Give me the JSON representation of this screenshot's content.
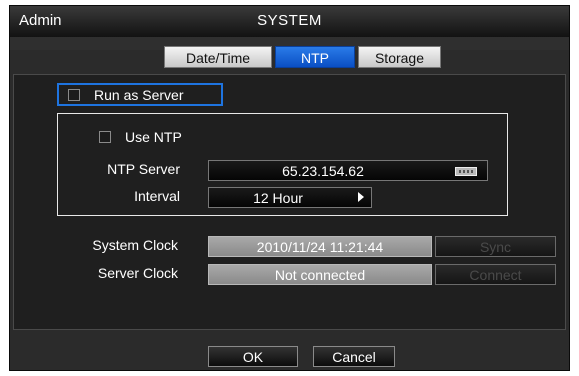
{
  "window": {
    "user": "Admin",
    "title": "SYSTEM"
  },
  "tabs": [
    {
      "label": "Date/Time",
      "active": false
    },
    {
      "label": "NTP",
      "active": true
    },
    {
      "label": "Storage",
      "active": false
    }
  ],
  "ntp": {
    "run_as_server_label": "Run as Server",
    "run_as_server_checked": false,
    "use_ntp_label": "Use NTP",
    "use_ntp_checked": false,
    "ntp_server_label": "NTP Server",
    "ntp_server_value": "65.23.154.62",
    "interval_label": "Interval",
    "interval_value": "12 Hour"
  },
  "clocks": {
    "system_clock_label": "System Clock",
    "system_clock_value": "2010/11/24  11:21:44",
    "sync_label": "Sync",
    "server_clock_label": "Server Clock",
    "server_clock_value": "Not connected",
    "connect_label": "Connect"
  },
  "footer": {
    "ok_label": "OK",
    "cancel_label": "Cancel"
  },
  "colors": {
    "accent": "#1e74e0",
    "tab_active": "#0a4fc4",
    "panel": "#1f1f1f",
    "field_gray": "#9a9a9a"
  },
  "icons": {
    "keyboard": "keyboard-icon",
    "interval_arrow": "triangle-right-icon"
  }
}
